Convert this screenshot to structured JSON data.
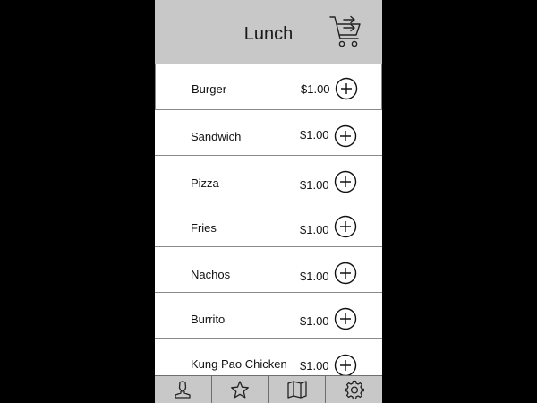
{
  "header": {
    "title": "Lunch",
    "cart_icon": "shopping-cart-checkout-icon"
  },
  "menu": {
    "items": [
      {
        "name": "Burger",
        "price": "$1.00"
      },
      {
        "name": "Sandwich",
        "price": "$1.00"
      },
      {
        "name": "Pizza",
        "price": "$1.00"
      },
      {
        "name": "Fries",
        "price": "$1.00"
      },
      {
        "name": "Nachos",
        "price": "$1.00"
      },
      {
        "name": "Burrito",
        "price": "$1.00"
      },
      {
        "name": "Kung Pao Chicken",
        "price": "$1.00"
      }
    ],
    "add_icon": "plus-circle-icon"
  },
  "tabbar": {
    "tabs": [
      {
        "icon": "user-icon"
      },
      {
        "icon": "star-icon"
      },
      {
        "icon": "map-icon"
      },
      {
        "icon": "gear-icon"
      }
    ]
  },
  "colors": {
    "background": "#000000",
    "header": "#c8c8c8",
    "surface": "#ffffff",
    "divider": "#8a8a8a"
  }
}
